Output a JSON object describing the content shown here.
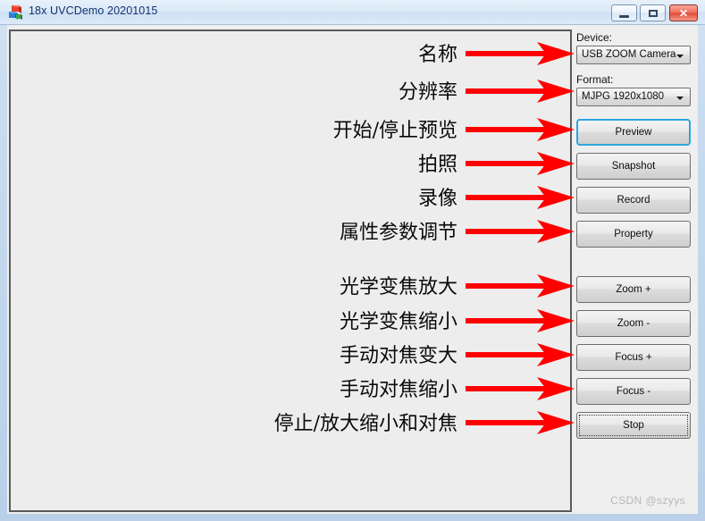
{
  "window": {
    "title": "18x UVCDemo 20201015",
    "app_icon": "app-blocks-icon",
    "caption": {
      "minimize": "minimize-icon",
      "maximize": "maximize-icon",
      "close": "✕"
    }
  },
  "controls": {
    "device_label": "Device:",
    "device_value": "USB ZOOM Camera",
    "format_label": "Format:",
    "format_value": "MJPG 1920x1080",
    "buttons": [
      {
        "id": "preview",
        "label": "Preview",
        "state": "default"
      },
      {
        "id": "snapshot",
        "label": "Snapshot",
        "state": "normal"
      },
      {
        "id": "record",
        "label": "Record",
        "state": "normal"
      },
      {
        "id": "property",
        "label": "Property",
        "state": "normal"
      },
      {
        "id": "zoom-in",
        "label": "Zoom +",
        "state": "normal"
      },
      {
        "id": "zoom-out",
        "label": "Zoom -",
        "state": "normal"
      },
      {
        "id": "focus-in",
        "label": "Focus +",
        "state": "normal"
      },
      {
        "id": "focus-out",
        "label": "Focus -",
        "state": "normal"
      },
      {
        "id": "stop",
        "label": "Stop",
        "state": "focused"
      }
    ]
  },
  "annotations": [
    {
      "text": "名称",
      "target": "device-combo"
    },
    {
      "text": "分辨率",
      "target": "format-combo"
    },
    {
      "text": "开始/停止预览",
      "target": "preview-button"
    },
    {
      "text": "拍照",
      "target": "snapshot-button"
    },
    {
      "text": "录像",
      "target": "record-button"
    },
    {
      "text": "属性参数调节",
      "target": "property-button"
    },
    {
      "text": "光学变焦放大",
      "target": "zoom-in-button"
    },
    {
      "text": "光学变焦缩小",
      "target": "zoom-out-button"
    },
    {
      "text": "手动对焦变大",
      "target": "focus-in-button"
    },
    {
      "text": "手动对焦缩小",
      "target": "focus-out-button"
    },
    {
      "text": "停止/放大缩小和对焦",
      "target": "stop-button"
    }
  ],
  "watermark": "CSDN @szyys",
  "colors": {
    "arrow": "#ff0000",
    "default_button_border": "#2ca5e0",
    "titlebar_text": "#13326b",
    "close_button": "#e04b36"
  }
}
